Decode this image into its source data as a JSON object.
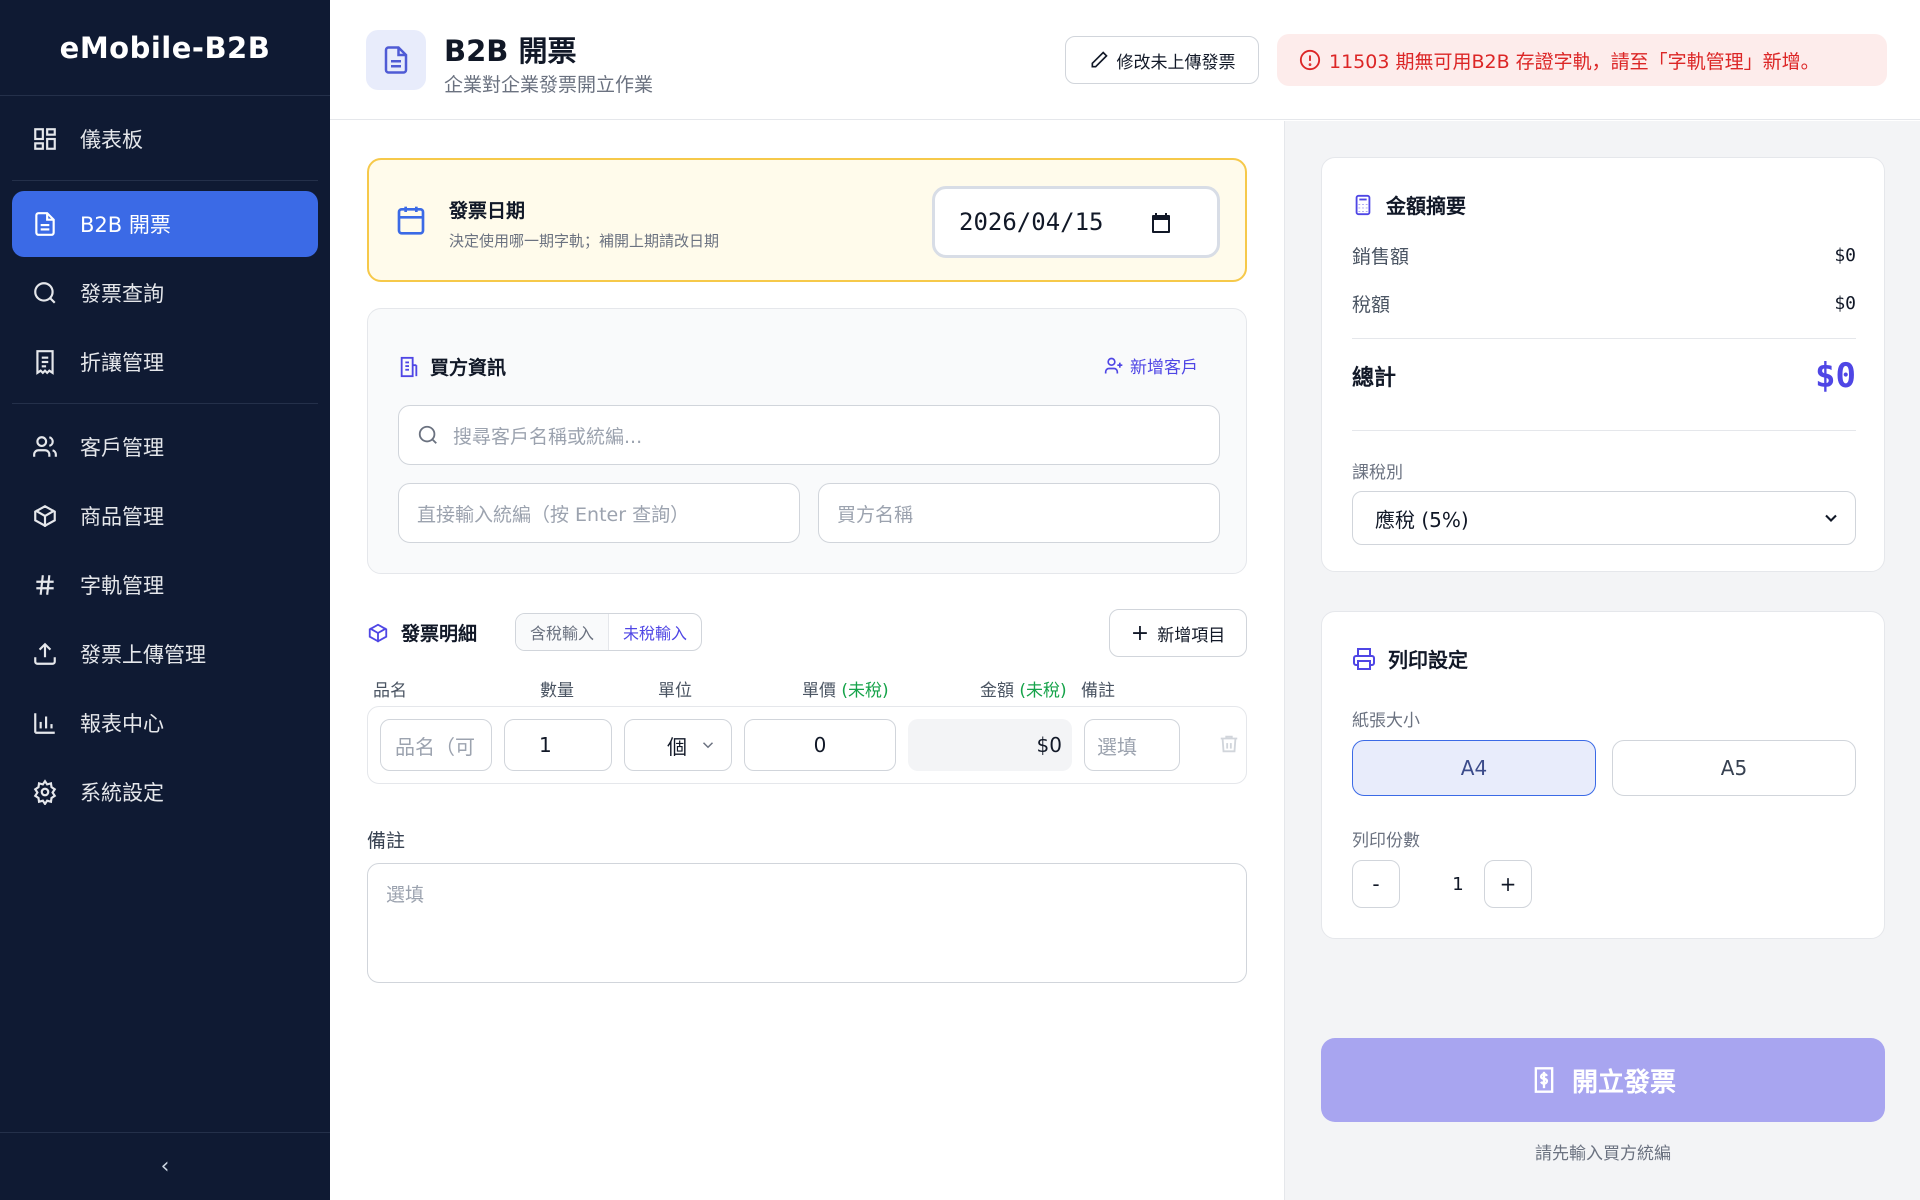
{
  "sidebar": {
    "brand": "eMobile-B2B",
    "items": [
      {
        "label": "儀表板",
        "icon": "dashboard-icon"
      },
      {
        "label": "B2B 開票",
        "icon": "document-icon"
      },
      {
        "label": "發票查詢",
        "icon": "search-icon"
      },
      {
        "label": "折讓管理",
        "icon": "receipt-icon"
      },
      {
        "label": "客戶管理",
        "icon": "users-icon"
      },
      {
        "label": "商品管理",
        "icon": "package-icon"
      },
      {
        "label": "字軌管理",
        "icon": "hash-icon"
      },
      {
        "label": "發票上傳管理",
        "icon": "upload-icon"
      },
      {
        "label": "報表中心",
        "icon": "bar-chart-icon"
      },
      {
        "label": "系統設定",
        "icon": "gear-icon"
      }
    ],
    "collapse_glyph": "‹"
  },
  "header": {
    "title": "B2B 開票",
    "subtitle": "企業對企業發票開立作業",
    "edit_button": "修改未上傳發票",
    "alert": "11503 期無可用B2B 存證字軌，請至「字軌管理」新增。"
  },
  "date_section": {
    "title": "發票日期",
    "hint": "決定使用哪一期字軌；補開上期請改日期",
    "value": "2026/04/15"
  },
  "buyer": {
    "title": "買方資訊",
    "add_customer": "新增客戶",
    "search_placeholder": "搜尋客戶名稱或統編...",
    "tax_id_placeholder": "直接輸入統編（按 Enter 查詢）",
    "name_placeholder": "買方名稱"
  },
  "details": {
    "title": "發票明細",
    "mode_tax_included": "含稅輸入",
    "mode_tax_excluded": "未稅輸入",
    "add_item": "新增項目",
    "columns": {
      "name": "品名",
      "qty": "數量",
      "unit": "單位",
      "price": "單價",
      "price_note": "(未稅)",
      "amount": "金額",
      "amount_note": "(未稅)",
      "remark": "備註"
    },
    "row": {
      "name_placeholder": "品名（可",
      "qty": "1",
      "unit": "個",
      "price": "0",
      "amount": "$0",
      "remark_placeholder": "選填"
    }
  },
  "note": {
    "label": "備註",
    "placeholder": "選填"
  },
  "summary": {
    "title": "金額摘要",
    "sales_label": "銷售額",
    "sales_value": "$0",
    "tax_label": "稅額",
    "tax_value": "$0",
    "total_label": "總計",
    "total_value": "$0",
    "tax_type_label": "課稅別",
    "tax_type_value": "應稅 (5%)"
  },
  "print": {
    "title": "列印設定",
    "paper_label": "紙張大小",
    "paper_a4": "A4",
    "paper_a5": "A5",
    "selected_paper": "A4",
    "copies_label": "列印份數",
    "minus": "-",
    "plus": "+",
    "copies": "1"
  },
  "action": {
    "issue_button": "開立發票",
    "hint": "請先輸入買方統編"
  },
  "colors": {
    "sidebar_bg": "#0f1a33",
    "active_nav": "#3b6ae6",
    "accent": "#4f46e5",
    "alert_text": "#dc2626",
    "alert_bg": "#fdeceb",
    "date_border": "#f6c94a",
    "issue_button": "#a8a5f0"
  }
}
